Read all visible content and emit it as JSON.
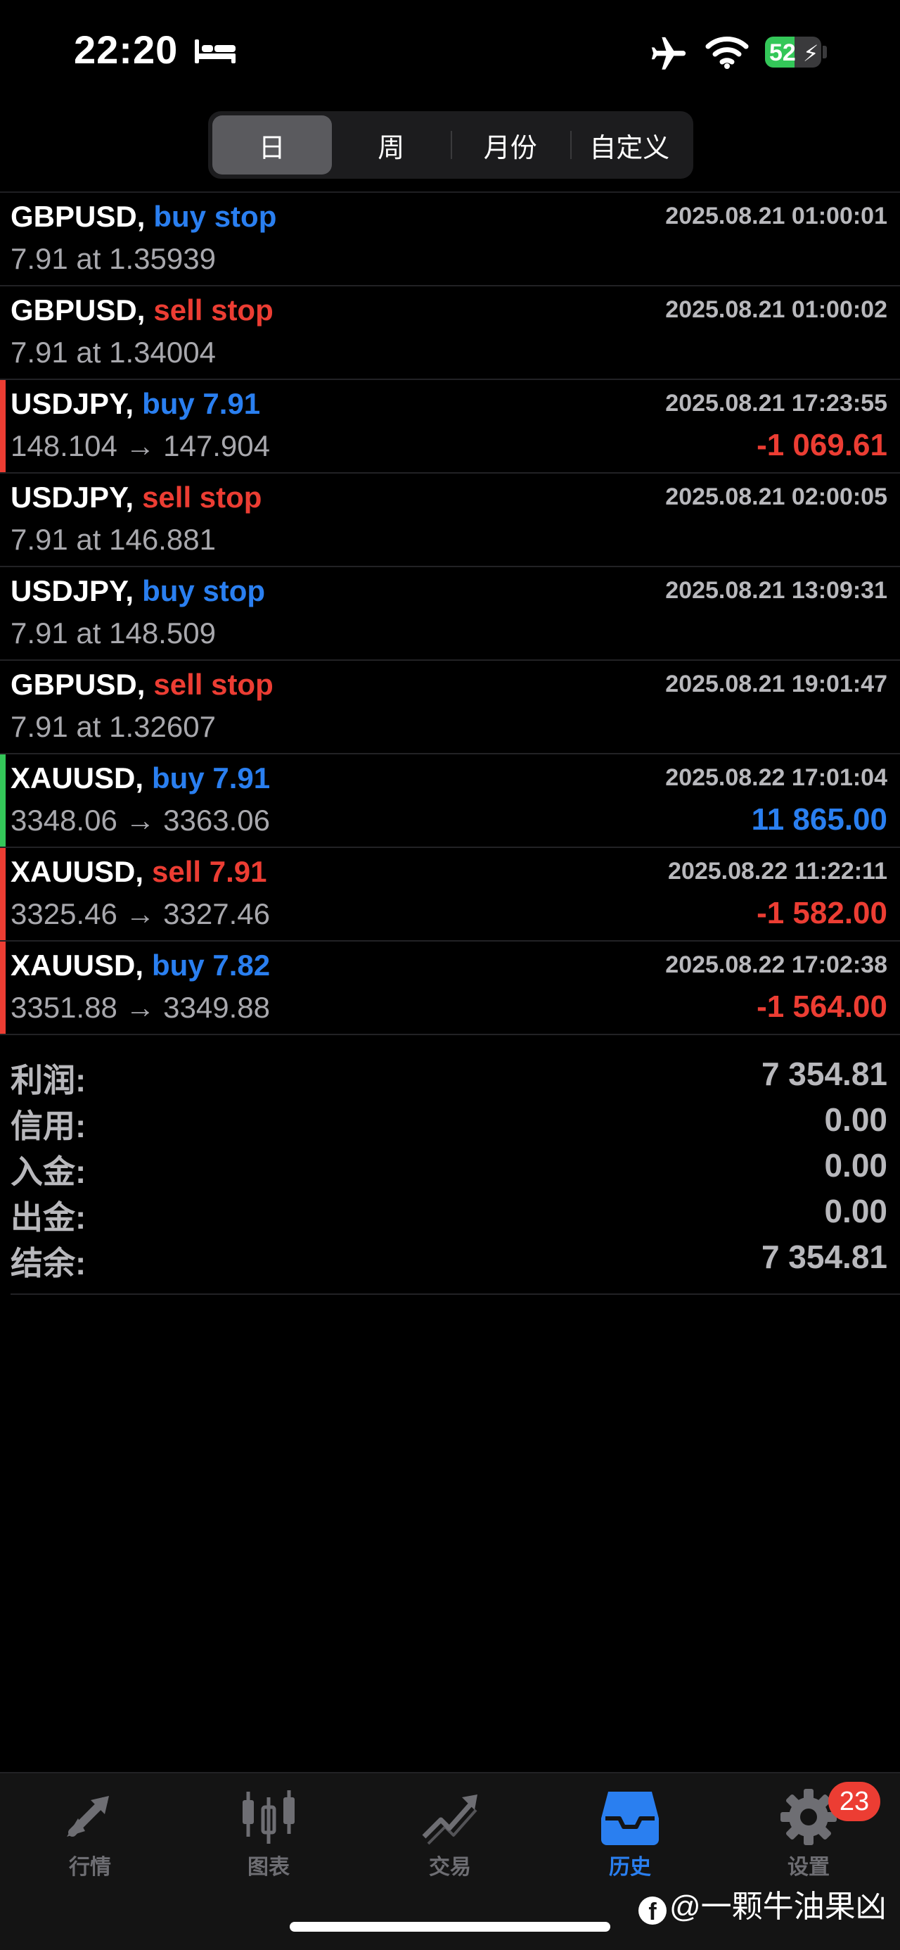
{
  "status_bar": {
    "time": "22:20",
    "battery": "52",
    "battery_fraction": 0.52,
    "battery_color": "#34c759"
  },
  "period_tabs": [
    {
      "label": "日",
      "active": true
    },
    {
      "label": "周",
      "active": false
    },
    {
      "label": "月份",
      "active": false
    },
    {
      "label": "自定义",
      "active": false
    }
  ],
  "deals": [
    {
      "symbol": "GBPUSD,",
      "action": "buy stop",
      "action_color": "blue",
      "time": "2025.08.21 01:00:01",
      "detail": "7.91 at 1.35939",
      "profit": "",
      "profit_color": "",
      "bar_color": ""
    },
    {
      "symbol": "GBPUSD,",
      "action": "sell stop",
      "action_color": "red",
      "time": "2025.08.21 01:00:02",
      "detail": "7.91 at 1.34004",
      "profit": "",
      "profit_color": "",
      "bar_color": ""
    },
    {
      "symbol": "USDJPY,",
      "action": "buy 7.91",
      "action_color": "blue",
      "time": "2025.08.21 17:23:55",
      "detail": "148.104 → 147.904",
      "profit": "-1 069.61",
      "profit_color": "red",
      "bar_color": "#ec3d33"
    },
    {
      "symbol": "USDJPY,",
      "action": "sell stop",
      "action_color": "red",
      "time": "2025.08.21 02:00:05",
      "detail": "7.91 at 146.881",
      "profit": "",
      "profit_color": "",
      "bar_color": ""
    },
    {
      "symbol": "USDJPY,",
      "action": "buy stop",
      "action_color": "blue",
      "time": "2025.08.21 13:09:31",
      "detail": "7.91 at 148.509",
      "profit": "",
      "profit_color": "",
      "bar_color": ""
    },
    {
      "symbol": "GBPUSD,",
      "action": "sell stop",
      "action_color": "red",
      "time": "2025.08.21 19:01:47",
      "detail": "7.91 at 1.32607",
      "profit": "",
      "profit_color": "",
      "bar_color": ""
    },
    {
      "symbol": "XAUUSD,",
      "action": "buy 7.91",
      "action_color": "blue",
      "time": "2025.08.22 17:01:04",
      "detail": "3348.06 → 3363.06",
      "profit": "11 865.00",
      "profit_color": "blue",
      "bar_color": "#34c759"
    },
    {
      "symbol": "XAUUSD,",
      "action": "sell 7.91",
      "action_color": "red",
      "time": "2025.08.22 11:22:11",
      "detail": "3325.46 → 3327.46",
      "profit": "-1 582.00",
      "profit_color": "red",
      "bar_color": "#ec3d33"
    },
    {
      "symbol": "XAUUSD,",
      "action": "buy 7.82",
      "action_color": "blue",
      "time": "2025.08.22 17:02:38",
      "detail": "3351.88 → 3349.88",
      "profit": "-1 564.00",
      "profit_color": "red",
      "bar_color": "#ec3d33"
    }
  ],
  "summary": [
    {
      "label": "利润:",
      "value": "7 354.81"
    },
    {
      "label": "信用:",
      "value": "0.00"
    },
    {
      "label": "入金:",
      "value": "0.00"
    },
    {
      "label": "出金:",
      "value": "0.00"
    },
    {
      "label": "结余:",
      "value": "7 354.81"
    }
  ],
  "tabbar": {
    "items": [
      {
        "label": "行情",
        "icon": "quotes-arrows-icon",
        "active": false
      },
      {
        "label": "图表",
        "icon": "candlestick-chart-icon",
        "active": false
      },
      {
        "label": "交易",
        "icon": "trade-trend-icon",
        "active": false
      },
      {
        "label": "历史",
        "icon": "history-inbox-icon",
        "active": true
      },
      {
        "label": "设置",
        "icon": "gear-icon",
        "active": false
      }
    ],
    "settings_badge": "23"
  },
  "watermark": {
    "text": "@一颗牛油果凶",
    "icon": "facebook-icon"
  },
  "colors": {
    "accent_blue": "#2a7ff0",
    "loss_red": "#ec3d33",
    "profit_green": "#34c759",
    "inactive_gray": "#6e6e73"
  }
}
